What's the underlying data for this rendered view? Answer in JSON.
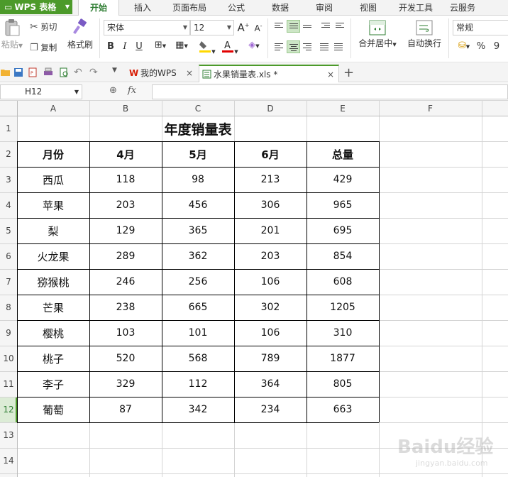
{
  "app": {
    "name": "WPS 表格"
  },
  "ribbon_tabs": [
    {
      "label": "开始",
      "active": true
    },
    {
      "label": "插入"
    },
    {
      "label": "页面布局"
    },
    {
      "label": "公式"
    },
    {
      "label": "数据"
    },
    {
      "label": "审阅"
    },
    {
      "label": "视图"
    },
    {
      "label": "开发工具"
    },
    {
      "label": "云服务"
    }
  ],
  "ribbon": {
    "paste": "粘贴",
    "cut": "剪切",
    "copy": "复制",
    "format_painter": "格式刷",
    "font_name": "宋体",
    "font_size": "12",
    "font_grow": "A",
    "font_shrink": "A",
    "bold": "B",
    "italic": "I",
    "underline": "U",
    "merge_center": "合并居中",
    "wrap_text": "自动换行",
    "number_format": "常规",
    "percent": "%",
    "comma": "9"
  },
  "doc_tabs": [
    {
      "label": "我的WPS"
    },
    {
      "label": "水果销量表.xls *",
      "active": true
    }
  ],
  "formula_bar": {
    "name_box": "H12",
    "fx": "fx",
    "value": ""
  },
  "columns": [
    "A",
    "B",
    "C",
    "D",
    "E",
    "F"
  ],
  "rows": [
    "1",
    "2",
    "3",
    "4",
    "5",
    "6",
    "7",
    "8",
    "9",
    "10",
    "11",
    "12",
    "13",
    "14"
  ],
  "selected_row": "12",
  "sheet": {
    "title": "年度销量表",
    "headers": [
      "月份",
      "4月",
      "5月",
      "6月",
      "总量"
    ],
    "data": [
      [
        "西瓜",
        "118",
        "98",
        "213",
        "429"
      ],
      [
        "苹果",
        "203",
        "456",
        "306",
        "965"
      ],
      [
        "梨",
        "129",
        "365",
        "201",
        "695"
      ],
      [
        "火龙果",
        "289",
        "362",
        "203",
        "854"
      ],
      [
        "猕猴桃",
        "246",
        "256",
        "106",
        "608"
      ],
      [
        "芒果",
        "238",
        "665",
        "302",
        "1205"
      ],
      [
        "樱桃",
        "103",
        "101",
        "106",
        "310"
      ],
      [
        "桃子",
        "520",
        "568",
        "789",
        "1877"
      ],
      [
        "李子",
        "329",
        "112",
        "364",
        "805"
      ],
      [
        "葡萄",
        "87",
        "342",
        "234",
        "663"
      ]
    ]
  },
  "watermark": {
    "brand": "Baidu经验",
    "url": "jingyan.baidu.com"
  },
  "colors": {
    "accent": "#4c9a2a",
    "active_tab_text": "#2e7d32",
    "grid_line": "#d4d4d4"
  }
}
